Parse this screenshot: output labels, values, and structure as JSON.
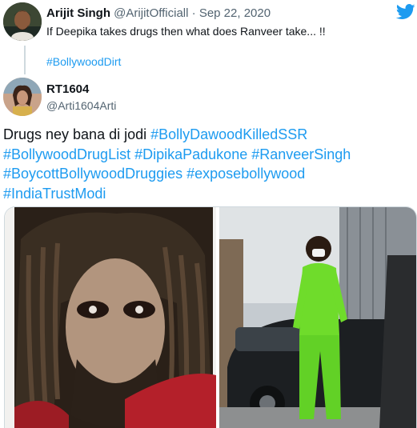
{
  "top_tweet": {
    "name": "Arijit Singh",
    "handle": "@ArijitOfficiall",
    "separator": "·",
    "date": "Sep 22, 2020",
    "text": "If Deepika takes drugs then what does Ranveer take... !!",
    "hashtag": "#BollywoodDirt"
  },
  "reply_tweet": {
    "name": "RT1604",
    "handle": "@Arti1604Arti",
    "text_plain": "Drugs ney bana di jodi ",
    "hashtags": [
      "#BollyDawoodKilledSSR",
      "#BollywoodDrugList",
      "#DipikaPadukone",
      "#RanveerSingh",
      "#BoycottBollywoodDruggies",
      "#exposebollywood",
      "#IndiaTrustModi"
    ]
  },
  "colors": {
    "link": "#1d9bf0",
    "text": "#0f1419",
    "muted": "#536471",
    "brand": "#1d9bf0",
    "divider": "#cfd9de"
  },
  "icons": {
    "brand": "twitter-bird-icon"
  }
}
